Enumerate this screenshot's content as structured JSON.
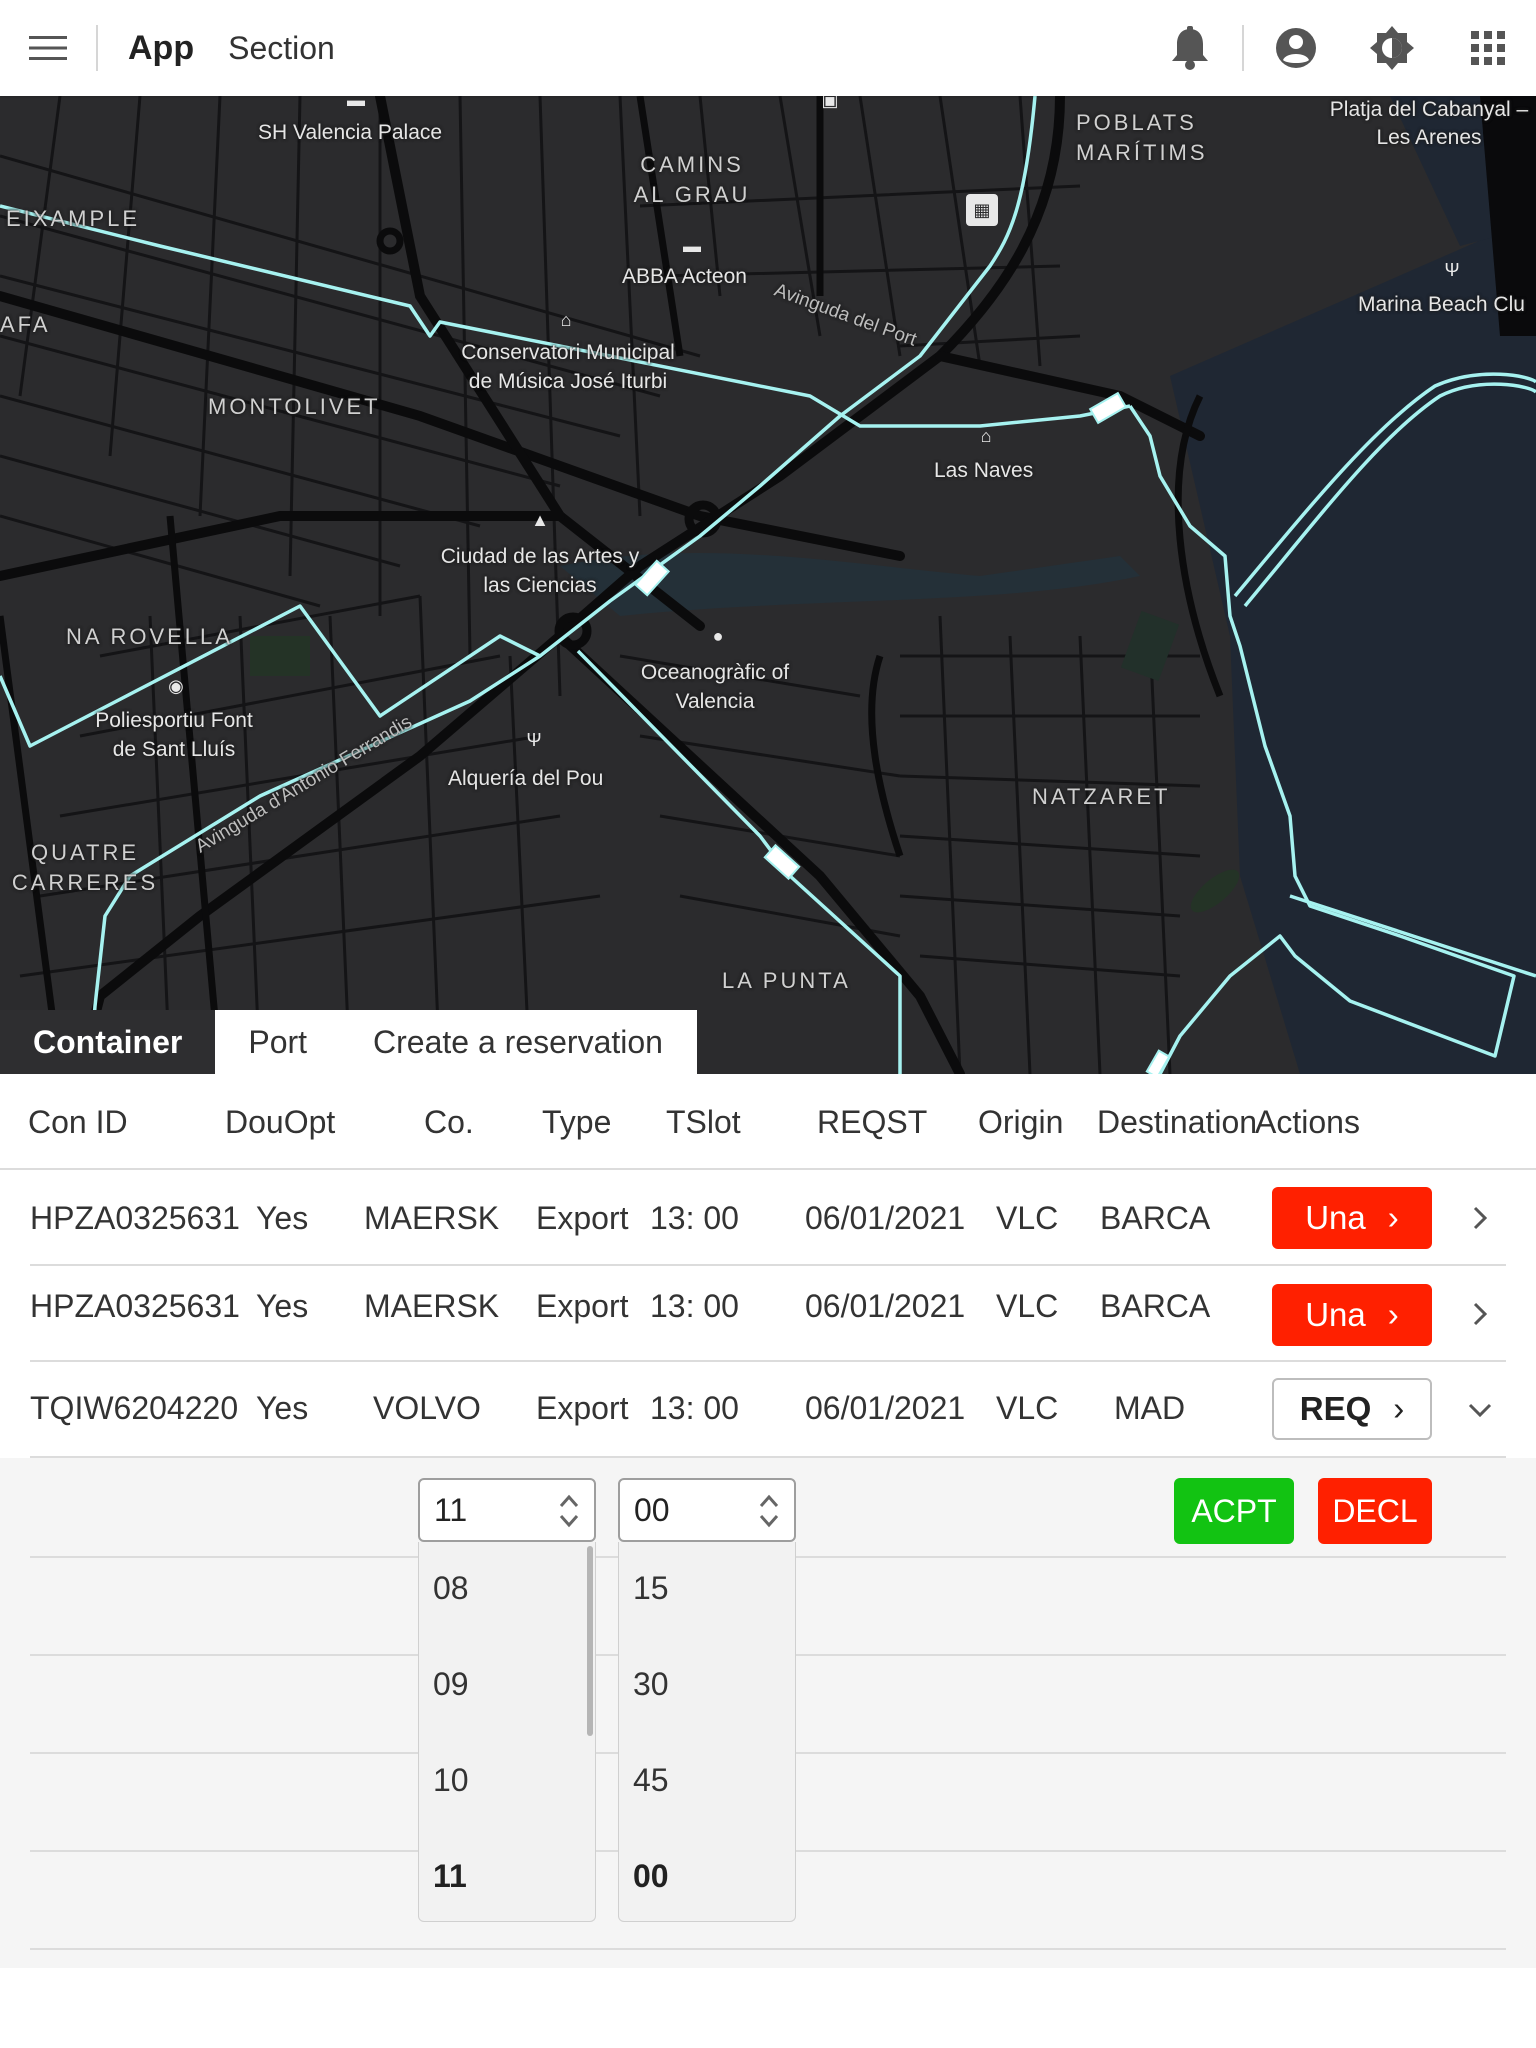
{
  "header": {
    "title": "App",
    "section": "Section",
    "icons": [
      "menu-icon",
      "bell-icon",
      "account-icon",
      "brightness-icon",
      "apps-grid-icon"
    ]
  },
  "map": {
    "districts": [
      "EIXAMPLE",
      "CAMINS AL GRAU",
      "POBLATS MARÍTIMS",
      "MONTOLIVET",
      "NA ROVELLA",
      "QUATRE CARRERES",
      "NATZARET",
      "LA PUNTA",
      "AFA"
    ],
    "places": [
      "SH Valencia Palace",
      "ABBA Acteon",
      "Conservatori Municipal de Música José Iturbi",
      "Las Naves",
      "Ciudad de las Artes y las Ciencias",
      "Oceanogràfic of Valencia",
      "Poliesportiu Font de Sant Lluís",
      "Alquería del Pou",
      "Platja del Cabanyal – Les Arenes",
      "Marina Beach Clu"
    ],
    "streets": [
      "Avinguda del Port",
      "Avinguda d'Antonio Ferrandis"
    ],
    "route_color": "#a6f2f0",
    "land_color": "#2b2b2d",
    "water_color": "#1f2733"
  },
  "tabs": [
    {
      "label": "Container",
      "active": true
    },
    {
      "label": "Port",
      "active": false
    },
    {
      "label": "Create a reservation",
      "active": false
    }
  ],
  "table": {
    "columns": [
      "Con ID",
      "DouOpt",
      "Co.",
      "Type",
      "TSlot",
      "REQST",
      "Origin",
      "Destination",
      "Actions"
    ],
    "rows": [
      {
        "con_id": "HPZA0325631",
        "douopt": "Yes",
        "co": "MAERSK",
        "type": "Export",
        "tslot": "13: 00",
        "reqst": "06/01/2021",
        "origin": "VLC",
        "destination": "BARCA",
        "action": "Una",
        "action_style": "red",
        "expanded": false
      },
      {
        "con_id": "HPZA0325631",
        "douopt": "Yes",
        "co": "MAERSK",
        "type": "Export",
        "tslot": "13: 00",
        "reqst": "06/01/2021",
        "origin": "VLC",
        "destination": "BARCA",
        "action": "Una",
        "action_style": "red",
        "expanded": false
      },
      {
        "con_id": "TQIW6204220",
        "douopt": "Yes",
        "co": "VOLVO",
        "type": "Export",
        "tslot": "13: 00",
        "reqst": "06/01/2021",
        "origin": "VLC",
        "destination": "MAD",
        "action": "REQ",
        "action_style": "outline",
        "expanded": true
      }
    ],
    "expanded": {
      "hour_select": {
        "value": "11",
        "options": [
          "08",
          "09",
          "10",
          "11"
        ],
        "selected": "11"
      },
      "minute_select": {
        "value": "00",
        "options": [
          "15",
          "30",
          "45",
          "00"
        ],
        "selected": "00"
      },
      "accept_label": "ACPT",
      "decline_label": "DECL",
      "accept_color": "#12c312",
      "decline_color": "#ff2000"
    }
  }
}
